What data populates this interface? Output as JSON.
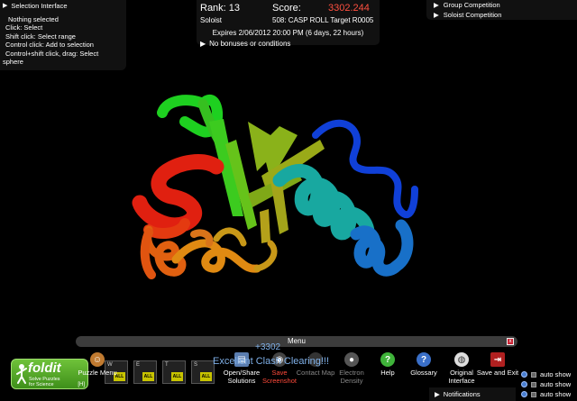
{
  "selection_panel": {
    "title": "Selection Interface",
    "lines": [
      "Nothing selected",
      "Click: Select",
      "Shift click: Select range",
      "Control click: Add to selection",
      "Control+shift click, drag: Select",
      "sphere"
    ]
  },
  "score_panel": {
    "rank_label": "Rank: 13",
    "score_label": "Score:",
    "score_value": "3302.244",
    "role": "Soloist",
    "puzzle": "508: CASP ROLL Target R0005",
    "expires": "Expires 2/06/2012 20:00 PM (6 days, 22 hours)",
    "bonus": "No bonuses or conditions"
  },
  "competition": {
    "group": "Group Competition",
    "soloist": "Soloist Competition"
  },
  "status": {
    "delta": "+3302",
    "message": "Excellent Clash Clearing!!!"
  },
  "menu": {
    "title": "Menu",
    "close": "x"
  },
  "toolbar": [
    {
      "label": "Puzzle Menu"
    },
    {
      "label": "Open/Share Solutions"
    },
    {
      "label": "Save Screenshot"
    },
    {
      "label": "Contact Map"
    },
    {
      "label": "Electron Density"
    },
    {
      "label": "Help"
    },
    {
      "label": "Glossary"
    },
    {
      "label": "Original Interface"
    },
    {
      "label": "Save and Exit"
    }
  ],
  "mini_panels": [
    {
      "letter": "W",
      "badge": "ALL"
    },
    {
      "letter": "E",
      "badge": "ALL"
    },
    {
      "letter": "T",
      "badge": "ALL"
    },
    {
      "letter": "S",
      "badge": "ALL"
    }
  ],
  "logo": {
    "name": "foldit",
    "tagline_1": "Solve Puzzles",
    "tagline_2": "for Science",
    "hotkey": "[H]"
  },
  "auto_show": [
    "auto show",
    "auto show",
    "auto show"
  ],
  "notifications": "Notifications",
  "colors": {
    "score_value": "#ff5040",
    "status_text": "#7fb0e8",
    "logo_green": "#6fc23a"
  }
}
